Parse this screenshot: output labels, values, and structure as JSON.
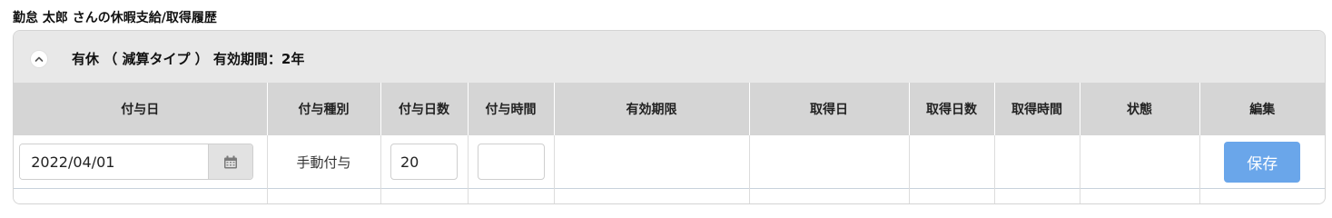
{
  "page": {
    "title": "勤怠 太郎 さんの休暇支給/取得履歴"
  },
  "panel": {
    "title": "有休 （ 減算タイプ ） 有効期間：2年",
    "collapse_icon": "chevron-up-icon"
  },
  "table": {
    "headers": [
      "付与日",
      "付与種別",
      "付与日数",
      "付与時間",
      "有効期限",
      "取得日",
      "取得日数",
      "取得時間",
      "状態",
      "編集"
    ],
    "row": {
      "grant_date": "2022/04/01",
      "grant_type": "手動付与",
      "grant_days": "20",
      "grant_hours": "",
      "expiry": "",
      "taken_date": "",
      "taken_days": "",
      "taken_hours": "",
      "status": "",
      "save_label": "保存"
    }
  },
  "colors": {
    "header_bg": "#d5d5d5",
    "panel_bg": "#e8e8e8",
    "save_button": "#6aa6ea"
  }
}
